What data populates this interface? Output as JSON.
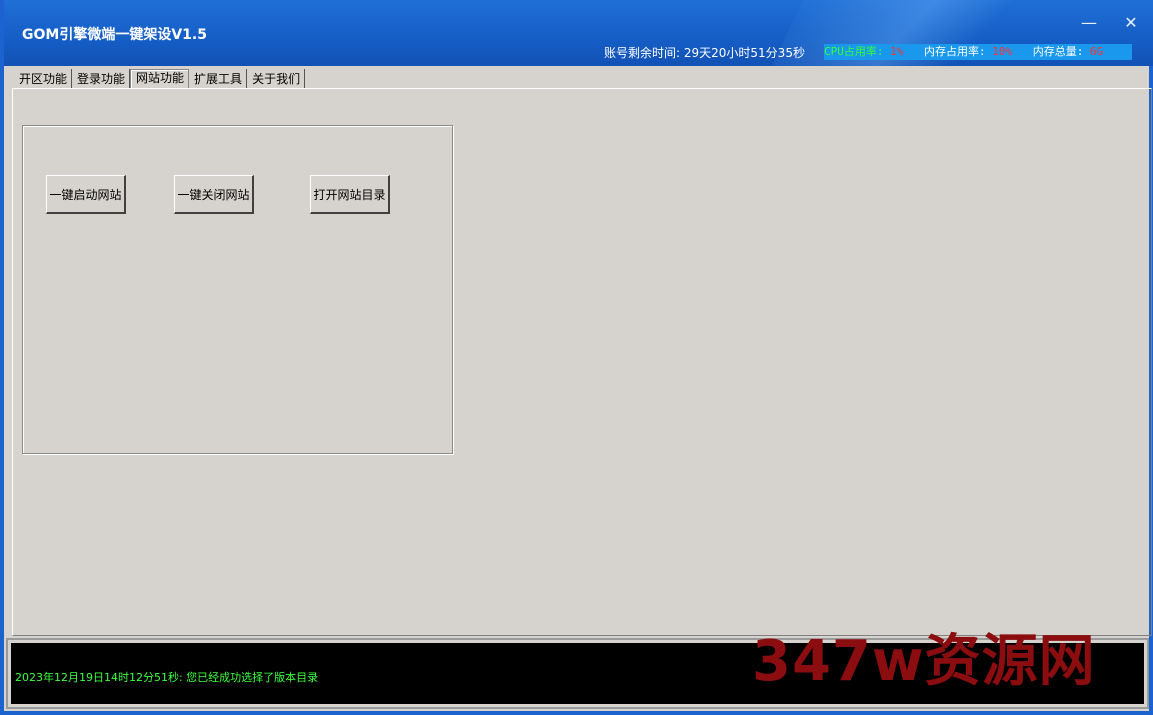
{
  "window": {
    "title": "GOM引擎微端一键架设V1.5",
    "minimize_glyph": "—",
    "close_glyph": "✕"
  },
  "status_bar": {
    "account_label": "账号剩余时间:",
    "account_value": "29天20小时51分35秒",
    "cpu_label": "CPU占用率:",
    "cpu_value": "1%",
    "mem_label": "内存占用率:",
    "mem_value": "10%",
    "mem_total_label": "内存总量:",
    "mem_total_value": "6G"
  },
  "tabs": [
    {
      "label": "开区功能"
    },
    {
      "label": "登录功能"
    },
    {
      "label": "网站功能"
    },
    {
      "label": "扩展工具"
    },
    {
      "label": "关于我们"
    }
  ],
  "active_tab": "网站功能",
  "buttons": {
    "start_site": "一键启动网站",
    "stop_site": "一键关闭网站",
    "open_dir": "打开网站目录"
  },
  "log": {
    "line": "2023年12月19日14时12分51秒: 您已经成功选择了版本目录"
  },
  "watermark": "347w资源网",
  "colors": {
    "titlebar": "#1f6fd6",
    "panel": "#d6d3ce",
    "log_text": "#3cff3c",
    "stat_label": "#35ff35",
    "stat_value": "#ff3030",
    "watermark": "#8b0d10"
  }
}
